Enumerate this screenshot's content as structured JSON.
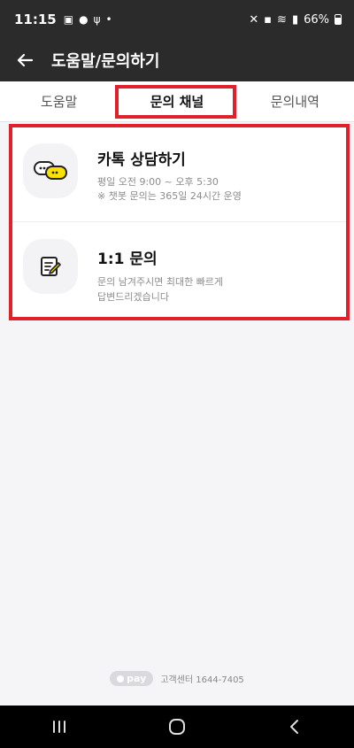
{
  "status_bar": {
    "time": "11:15",
    "battery": "66%",
    "icons": [
      "gallery-icon",
      "chat-icon",
      "usb-icon",
      "dot-icon",
      "mute-icon",
      "lock-icon",
      "wifi-icon",
      "signal-icon",
      "battery-icon"
    ]
  },
  "header": {
    "title": "도움말/문의하기"
  },
  "tabs": [
    {
      "label": "도움말",
      "active": false
    },
    {
      "label": "문의 채널",
      "active": true
    },
    {
      "label": "문의내역",
      "active": false
    }
  ],
  "channels": [
    {
      "title": "카톡 상담하기",
      "lines": [
        "평일 오전 9:00 ~ 오후 5:30",
        "※ 챗봇 문의는 365일 24시간 운영"
      ],
      "icon": "chat-bubbles-icon"
    },
    {
      "title": "1:1 문의",
      "lines": [
        "문의 남겨주시면 최대한 빠르게",
        "답변드리겠습니다"
      ],
      "icon": "memo-edit-icon"
    }
  ],
  "footer": {
    "pay_label": "pay",
    "customer_center": "고객센터 1644-7405"
  },
  "colors": {
    "header_bg": "#2b2b2b",
    "highlight": "#e0202a",
    "kakao_yellow": "#fae100"
  }
}
